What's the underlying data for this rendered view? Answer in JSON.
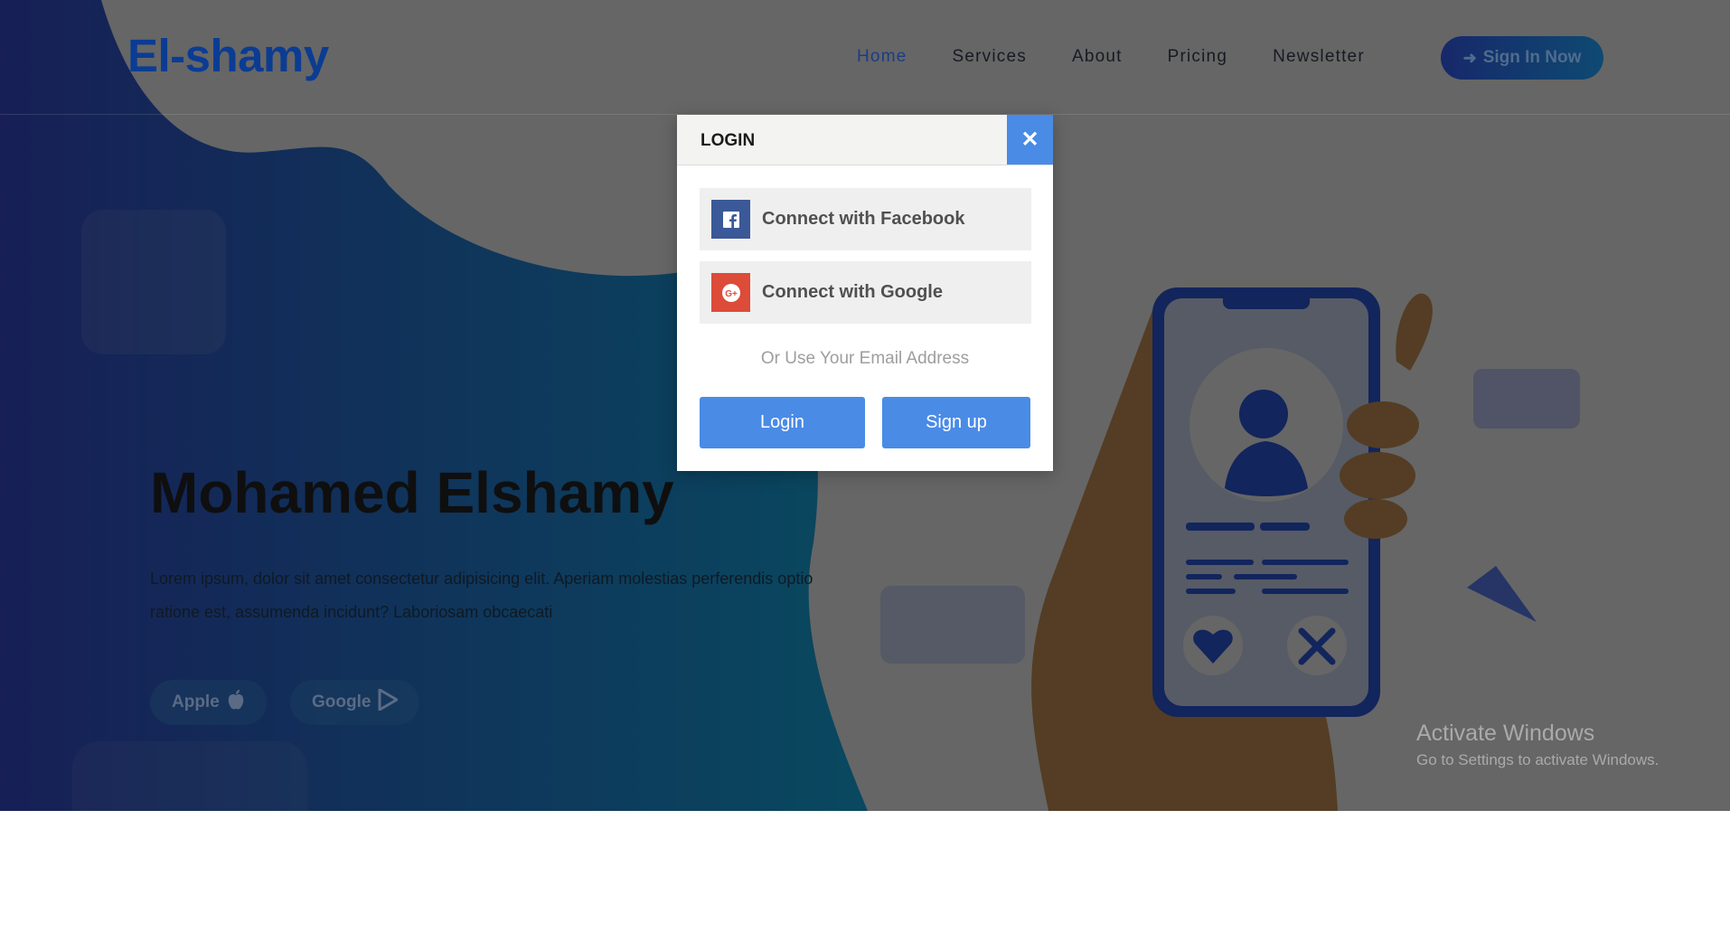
{
  "header": {
    "logo": "El-shamy",
    "nav": [
      "Home",
      "Services",
      "About",
      "Pricing",
      "Newsletter"
    ],
    "active": "Home",
    "signin_label": "Sign In Now",
    "signin_icon": "sign-in-icon"
  },
  "hero": {
    "title": "Mohamed Elshamy",
    "text": "Lorem ipsum, dolor sit amet consectetur adipisicing elit. Aperiam molestias perferendis optio ratione est, assumenda incidunt? Laboriosam obcaecati",
    "stores": [
      {
        "label": "Apple",
        "icon": "apple-icon"
      },
      {
        "label": "Google",
        "icon": "google-play-icon"
      }
    ]
  },
  "modal": {
    "title": "LOGIN",
    "close_icon": "close-icon",
    "facebook_label": "Connect with Facebook",
    "google_label": "Connect with Google",
    "or_text": "Or Use Your Email Address",
    "login_label": "Login",
    "signup_label": "Sign up"
  },
  "watermark": {
    "line1": "Activate Windows",
    "line2": "Go to Settings to activate Windows."
  },
  "colors": {
    "accent": "#4a8be6",
    "facebook": "#3b5998",
    "google": "#dd4b39",
    "brand_blue": "#0b3c94"
  }
}
